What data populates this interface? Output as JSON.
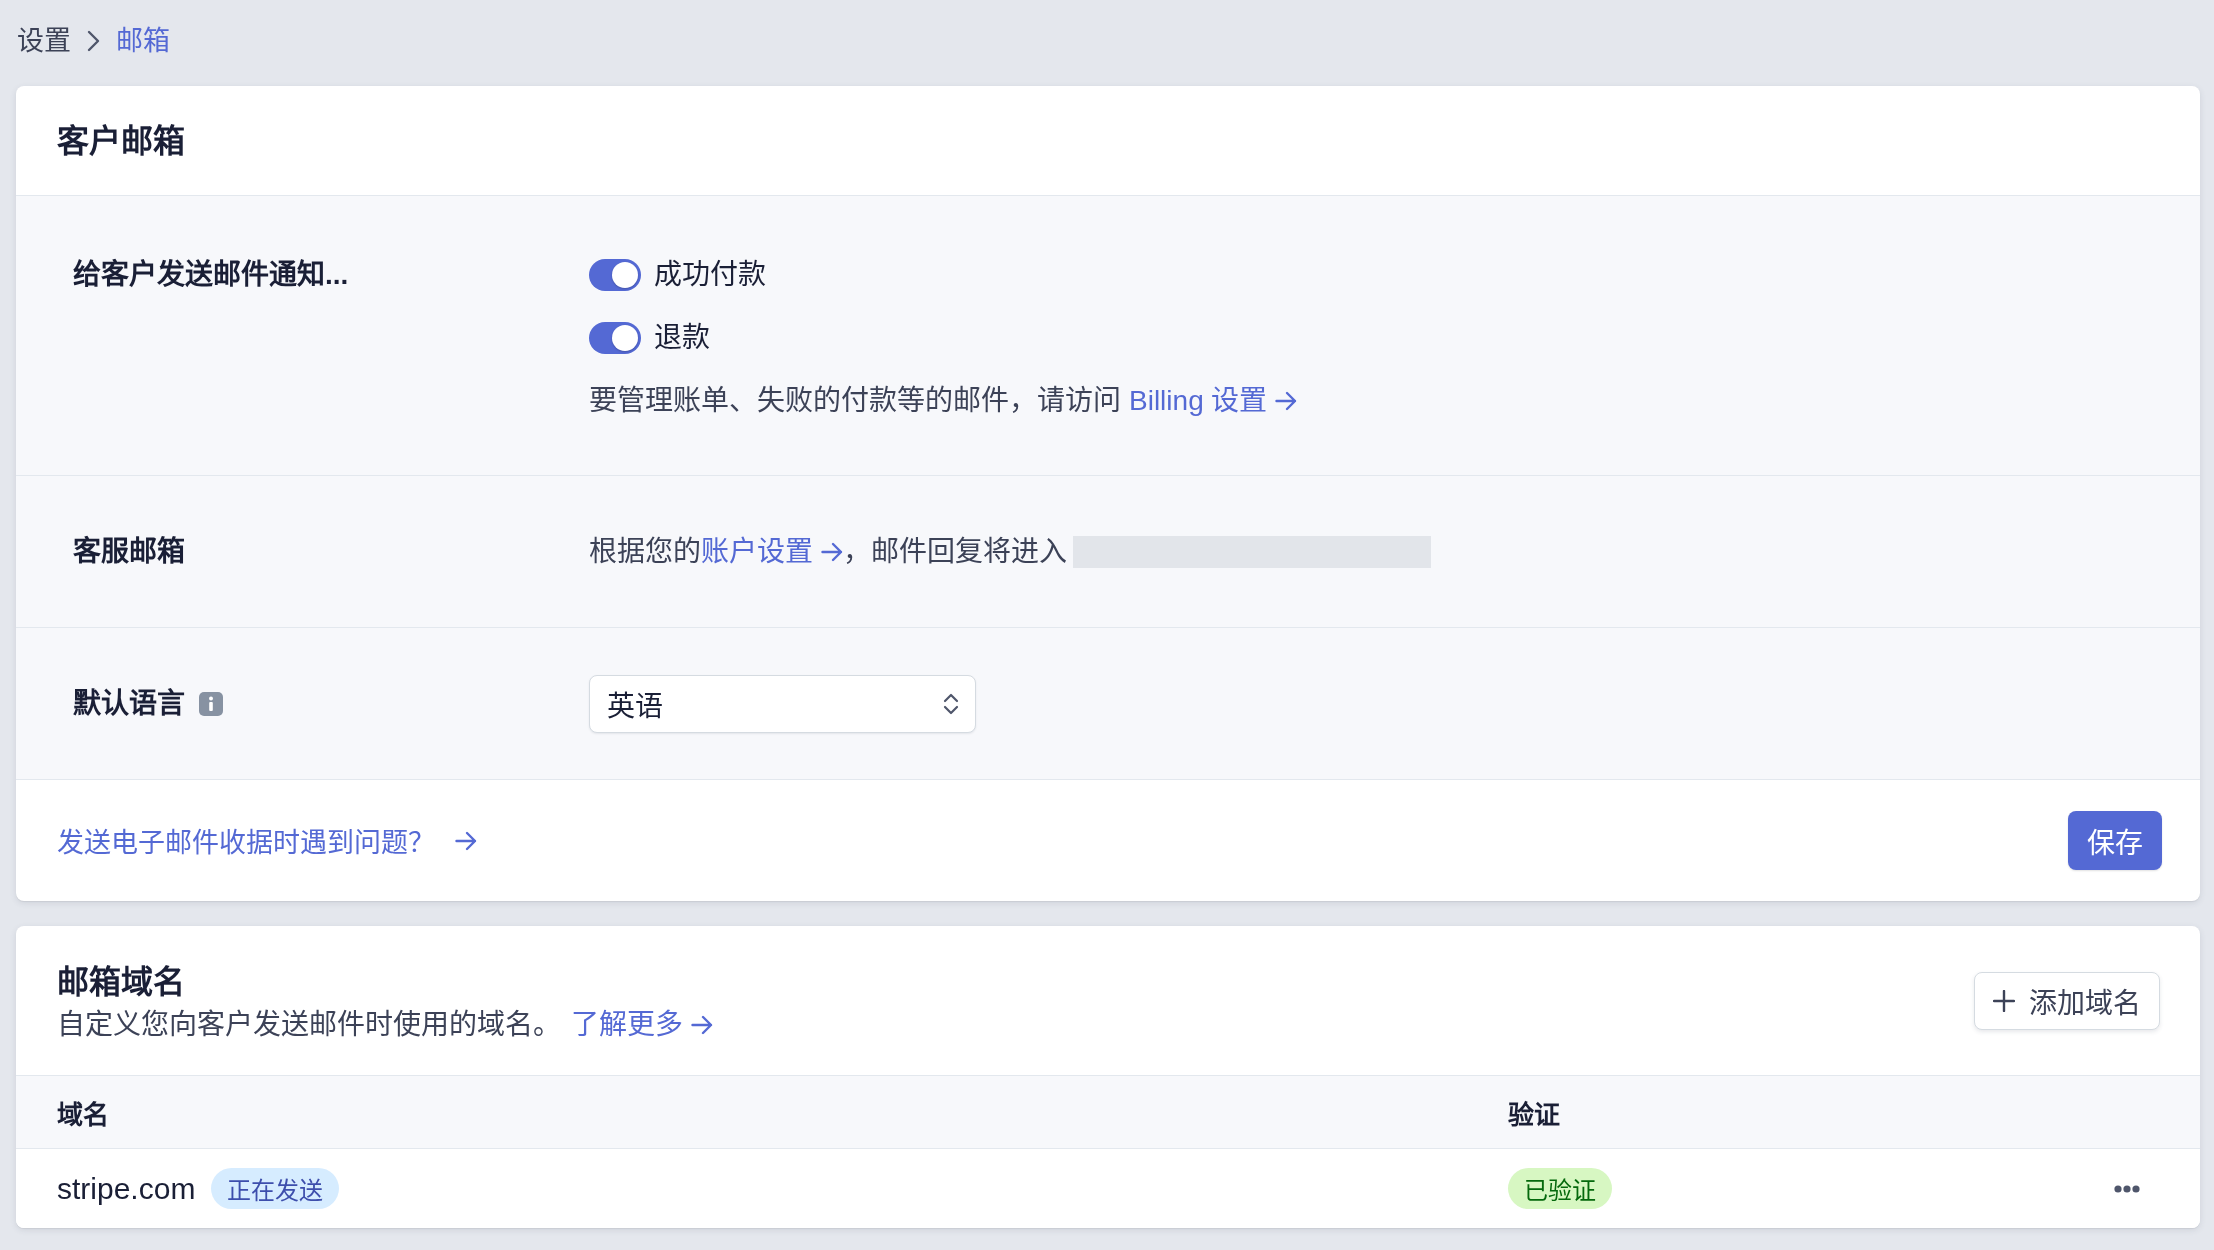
{
  "breadcrumb": [
    {
      "label": "设置",
      "current": false
    },
    {
      "label": "邮箱",
      "current": true
    }
  ],
  "customer_emails": {
    "title": "客户邮箱",
    "notifications": {
      "label": "给客户发送邮件通知...",
      "toggles": [
        {
          "label": "成功付款",
          "on": true
        },
        {
          "label": "退款",
          "on": true
        }
      ],
      "note": {
        "text": "要管理账单、失败的付款等的邮件，请访问",
        "link": "Billing 设置"
      }
    },
    "support_email": {
      "label": "客服邮箱",
      "text_before": "根据您的",
      "link": "账户设置",
      "text_after": "，邮件回复将进入",
      "reply_address_redacted": true
    },
    "default_language": {
      "label": "默认语言",
      "value": "英语"
    },
    "help_link": "发送电子邮件收据时遇到问题？",
    "save_button": "保存"
  },
  "email_domains": {
    "title": "邮箱域名",
    "description": "自定义您向客户发送邮件时使用的域名。",
    "learn_more": "了解更多",
    "add_button": "添加域名",
    "table": {
      "columns": [
        "域名",
        "验证"
      ],
      "rows": [
        {
          "domain": "stripe.com",
          "status": {
            "label": "正在发送",
            "kind": "sending"
          },
          "verification": {
            "label": "已验证",
            "kind": "verified"
          }
        }
      ]
    }
  }
}
